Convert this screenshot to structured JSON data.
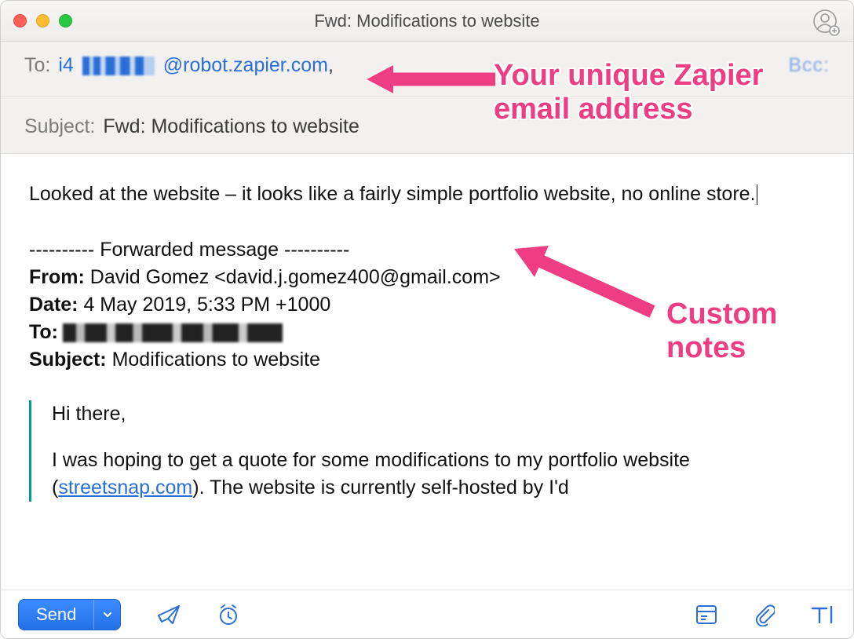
{
  "window": {
    "title": "Fwd: Modifications to website"
  },
  "header": {
    "to_label": "To:",
    "to_prefix": "i4",
    "to_suffix": "@robot.zapier.com",
    "to_trailing_comma": ",",
    "subject_label": "Subject:",
    "subject_value": "Fwd: Modifications to website",
    "ccbcc_hint": "Bcc:"
  },
  "body": {
    "note": "Looked at the website – it looks like a fairly simple portfolio website, no online store.",
    "fwd_separator": "---------- Forwarded message ----------",
    "fwd_from_label": "From:",
    "fwd_from_value": " David Gomez <david.j.gomez400@gmail.com>",
    "fwd_date_label": "Date:",
    "fwd_date_value": " 4 May 2019, 5:33 PM +1000",
    "fwd_to_label": "To:",
    "fwd_subject_label": "Subject:",
    "fwd_subject_value": " Modifications to website",
    "quote_greeting": "Hi there,",
    "quote_para_pre": "I was hoping to get a quote for some modifications to my portfolio website (",
    "quote_link_text": "streetsnap.com",
    "quote_para_post": "). The website is currently self-hosted by I'd"
  },
  "toolbar": {
    "send_label": "Send"
  },
  "annotations": {
    "a1": "Your unique Zapier email address",
    "a2": "Custom notes"
  },
  "colors": {
    "accent_blue": "#2a6fd6",
    "annotation_pink": "#ee3d82",
    "quote_border": "#059a8f"
  }
}
